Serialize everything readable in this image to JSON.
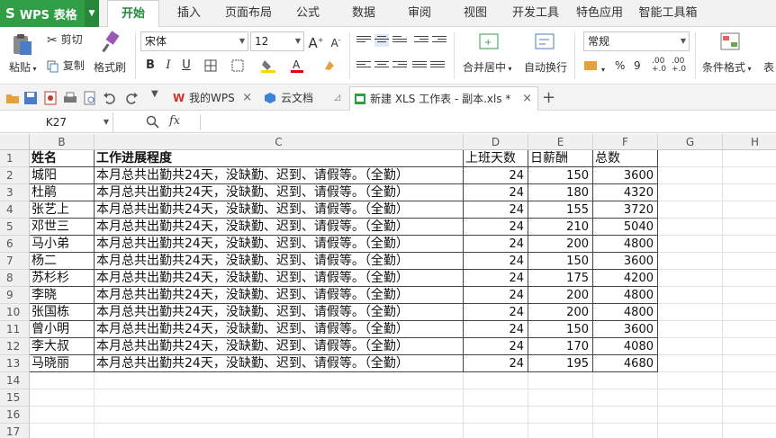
{
  "app": {
    "logo": "S",
    "title": "WPS 表格"
  },
  "menu_tabs": [
    "开始",
    "插入",
    "页面布局",
    "公式",
    "数据",
    "审阅",
    "视图",
    "开发工具",
    "特色应用",
    "智能工具箱"
  ],
  "ribbon": {
    "paste": "粘贴",
    "cut": "剪切",
    "copy": "复制",
    "format_painter": "格式刷",
    "font_name": "宋体",
    "font_size": "12",
    "bold": "B",
    "italic": "I",
    "underline": "U",
    "merge_center": "合并居中",
    "wrap_text": "自动换行",
    "number_format": "常规",
    "percent": "%",
    "comma": "9",
    "inc_decimal": ".00 +.0",
    "dec_decimal": ".00 +.0",
    "cond_format": "条件格式",
    "table_style": "表",
    "grow_font": "A",
    "shrink_font": "A"
  },
  "doc_tabs": [
    {
      "label": "我的WPS"
    },
    {
      "label": "云文档"
    },
    {
      "label": "新建 XLS 工作表 - 副本.xls *"
    }
  ],
  "formula_bar": {
    "cell_ref": "K27",
    "fx": "fx"
  },
  "columns": [
    "B",
    "C",
    "D",
    "E",
    "F",
    "G",
    "H"
  ],
  "header_row": [
    "姓名",
    "工作进展程度",
    "上班天数",
    "日薪酬",
    "总数"
  ],
  "rows": [
    {
      "n": "2",
      "name": "城阳",
      "desc": "本月总共出勤共24天，没缺勤、迟到、请假等。（全勤）",
      "days": "24",
      "daily": "150",
      "total": "3600"
    },
    {
      "n": "3",
      "name": "杜鹃",
      "desc": "本月总共出勤共24天，没缺勤、迟到、请假等。（全勤）",
      "days": "24",
      "daily": "180",
      "total": "4320"
    },
    {
      "n": "4",
      "name": "张艺上",
      "desc": "本月总共出勤共24天，没缺勤、迟到、请假等。（全勤）",
      "days": "24",
      "daily": "155",
      "total": "3720"
    },
    {
      "n": "5",
      "name": "邓世三",
      "desc": "本月总共出勤共24天，没缺勤、迟到、请假等。（全勤）",
      "days": "24",
      "daily": "210",
      "total": "5040"
    },
    {
      "n": "6",
      "name": "马小弟",
      "desc": "本月总共出勤共24天，没缺勤、迟到、请假等。（全勤）",
      "days": "24",
      "daily": "200",
      "total": "4800"
    },
    {
      "n": "7",
      "name": "杨二",
      "desc": "本月总共出勤共24天，没缺勤、迟到、请假等。（全勤）",
      "days": "24",
      "daily": "150",
      "total": "3600"
    },
    {
      "n": "8",
      "name": "苏杉杉",
      "desc": "本月总共出勤共24天，没缺勤、迟到、请假等。（全勤）",
      "days": "24",
      "daily": "175",
      "total": "4200"
    },
    {
      "n": "9",
      "name": "李晓",
      "desc": "本月总共出勤共24天，没缺勤、迟到、请假等。（全勤）",
      "days": "24",
      "daily": "200",
      "total": "4800"
    },
    {
      "n": "10",
      "name": "张国栋",
      "desc": "本月总共出勤共24天，没缺勤、迟到、请假等。（全勤）",
      "days": "24",
      "daily": "200",
      "total": "4800"
    },
    {
      "n": "11",
      "name": "曾小明",
      "desc": "本月总共出勤共24天，没缺勤、迟到、请假等。（全勤）",
      "days": "24",
      "daily": "150",
      "total": "3600"
    },
    {
      "n": "12",
      "name": "李大叔",
      "desc": "本月总共出勤共24天，没缺勤、迟到、请假等。（全勤）",
      "days": "24",
      "daily": "170",
      "total": "4080"
    },
    {
      "n": "13",
      "name": "马晓丽",
      "desc": "本月总共出勤共24天，没缺勤、迟到、请假等。（全勤）",
      "days": "24",
      "daily": "195",
      "total": "4680"
    }
  ],
  "empty_rows": [
    "14",
    "15",
    "16",
    "17"
  ],
  "header_row_number": "1",
  "colors": {
    "brand": "#2f9e45",
    "active_tab_text": "#1f8b3a"
  }
}
